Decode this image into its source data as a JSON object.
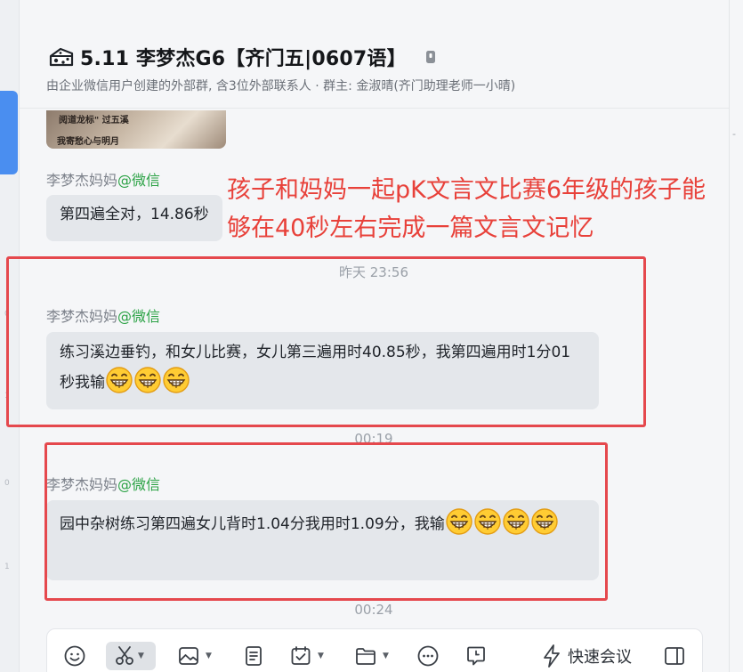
{
  "header": {
    "title": "5.11 李梦杰G6【齐门五|0607语】",
    "subtitle": "由企业微信用户创建的外部群, 含3位外部联系人 · 群主: 金淑晴(齐门助理老师一小晴)"
  },
  "annotation": {
    "text": "孩子和妈妈一起pK文言文比赛6年级的孩子能够在40秒左右完成一篇文言文记忆"
  },
  "messages": [
    {
      "sender": "李梦杰妈妈",
      "source": "@微信",
      "text": "第四遍全对，14.86秒"
    },
    {
      "time": "昨天 23:56",
      "sender": "李梦杰妈妈",
      "source": "@微信",
      "text": "练习溪边垂钓，和女儿比赛，女儿第三遍用时40.85秒，我第四遍用时1分01秒我输"
    },
    {
      "time": "00:19",
      "sender": "李梦杰妈妈",
      "source": "@微信",
      "text": "园中杂树练习第四遍女儿背时1.04分我用时1.09分，我输"
    }
  ],
  "times": {
    "after_last": "00:24"
  },
  "toolbar": {
    "quick_meeting_label": "快速会议"
  },
  "image_scribble": {
    "line1": "阅道龙标\" 过五溪",
    "line2": "我寄愁心与明月"
  },
  "colors": {
    "annotation": "#e8413a",
    "redbox": "#e5484d",
    "wechat_source": "#2ba245",
    "bubble": "#e4e7eb",
    "active_nav": "#4a8ef0"
  },
  "icons": [
    "group-icon",
    "lock-icon",
    "grin-emoji",
    "smile-icon",
    "scissors-icon",
    "image-icon",
    "document-icon",
    "calendar-icon",
    "folder-icon",
    "more-icon",
    "message-icon",
    "lightning-icon",
    "sidebar-icon"
  ]
}
